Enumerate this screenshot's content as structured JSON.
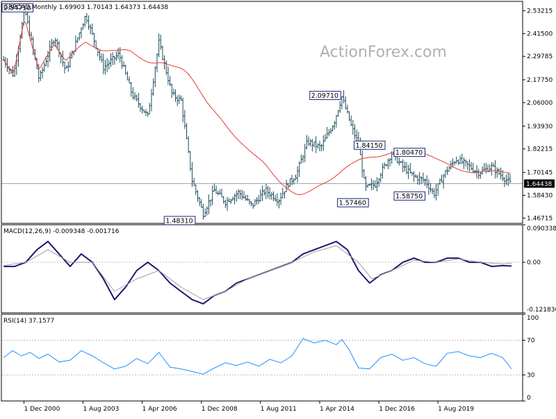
{
  "chart_data": [
    {
      "type": "ohlc",
      "panel": "price",
      "title": "GBPCAD,Monthly",
      "ohlc_header": "1.69903 1.70143 1.64373 1.64438",
      "ylim": [
        1.44,
        2.58
      ],
      "y_ticks": [
        "2.53215",
        "2.41500",
        "2.29785",
        "2.17750",
        "2.06000",
        "1.93930",
        "1.82215",
        "1.70145",
        "1.58430",
        "1.46715"
      ],
      "current_price": "1.64438",
      "ma_color": "#e53935",
      "bar_color": "#1a4a5a",
      "annotations": [
        {
          "label": "2.54710",
          "time": 2000.95,
          "value": 2.5471
        },
        {
          "label": "1.48310",
          "time": 2008.7,
          "value": 1.4831
        },
        {
          "label": "2.09710",
          "time": 2015.2,
          "value": 2.0971
        },
        {
          "label": "1.84150",
          "time": 2015.8,
          "value": 1.8415
        },
        {
          "label": "1.57460",
          "time": 2016.45,
          "value": 1.5746
        },
        {
          "label": "1.80470",
          "time": 2017.6,
          "value": 1.8047
        },
        {
          "label": "1.58750",
          "time": 2019.0,
          "value": 1.5875
        }
      ],
      "key_points": [
        [
          2000.0,
          2.28
        ],
        [
          2000.45,
          2.2
        ],
        [
          2000.95,
          2.54
        ],
        [
          2001.6,
          2.18
        ],
        [
          2002.3,
          2.4
        ],
        [
          2002.8,
          2.22
        ],
        [
          2003.7,
          2.51
        ],
        [
          2004.5,
          2.24
        ],
        [
          2005.2,
          2.31
        ],
        [
          2005.8,
          2.1
        ],
        [
          2006.5,
          1.99
        ],
        [
          2007.0,
          2.37
        ],
        [
          2007.6,
          2.1
        ],
        [
          2008.0,
          2.07
        ],
        [
          2008.5,
          1.66
        ],
        [
          2009.0,
          1.49
        ],
        [
          2009.5,
          1.61
        ],
        [
          2010.0,
          1.55
        ],
        [
          2010.6,
          1.6
        ],
        [
          2011.2,
          1.53
        ],
        [
          2011.8,
          1.61
        ],
        [
          2012.4,
          1.56
        ],
        [
          2012.8,
          1.64
        ],
        [
          2013.2,
          1.69
        ],
        [
          2013.7,
          1.86
        ],
        [
          2014.3,
          1.83
        ],
        [
          2014.9,
          1.96
        ],
        [
          2015.25,
          2.09
        ],
        [
          2015.7,
          1.93
        ],
        [
          2016.0,
          1.85
        ],
        [
          2016.3,
          1.62
        ],
        [
          2016.75,
          1.64
        ],
        [
          2017.0,
          1.7
        ],
        [
          2017.5,
          1.8
        ],
        [
          2018.0,
          1.73
        ],
        [
          2018.5,
          1.68
        ],
        [
          2019.0,
          1.66
        ],
        [
          2019.4,
          1.59
        ],
        [
          2019.9,
          1.7
        ],
        [
          2020.4,
          1.77
        ],
        [
          2020.9,
          1.74
        ],
        [
          2021.4,
          1.7
        ],
        [
          2022.0,
          1.73
        ],
        [
          2022.5,
          1.68
        ],
        [
          2022.9,
          1.64
        ]
      ]
    },
    {
      "type": "line",
      "panel": "macd",
      "title": "MACD(12,26,9) -0.009348 -0.001716",
      "ylim": [
        -0.121836,
        0.090338
      ],
      "y_ticks": [
        "0.090338",
        "0.00",
        "-0.121836"
      ],
      "zero_label": "0.00",
      "series": [
        {
          "role": "macd",
          "color": "#191970",
          "points": [
            [
              2000.0,
              -0.01
            ],
            [
              2000.5,
              -0.01
            ],
            [
              2001.0,
              0.0
            ],
            [
              2001.5,
              0.03
            ],
            [
              2002.0,
              0.05
            ],
            [
              2002.5,
              0.02
            ],
            [
              2003.0,
              -0.01
            ],
            [
              2003.5,
              0.02
            ],
            [
              2004.0,
              0.0
            ],
            [
              2004.5,
              -0.04
            ],
            [
              2005.0,
              -0.09
            ],
            [
              2005.5,
              -0.06
            ],
            [
              2006.0,
              -0.02
            ],
            [
              2006.5,
              0.0
            ],
            [
              2007.0,
              -0.02
            ],
            [
              2007.5,
              -0.05
            ],
            [
              2008.0,
              -0.07
            ],
            [
              2008.5,
              -0.09
            ],
            [
              2009.0,
              -0.1
            ],
            [
              2009.5,
              -0.08
            ],
            [
              2010.0,
              -0.07
            ],
            [
              2010.5,
              -0.05
            ],
            [
              2011.0,
              -0.04
            ],
            [
              2011.5,
              -0.03
            ],
            [
              2012.0,
              -0.02
            ],
            [
              2012.5,
              -0.01
            ],
            [
              2013.0,
              0.0
            ],
            [
              2013.5,
              0.02
            ],
            [
              2014.0,
              0.03
            ],
            [
              2014.5,
              0.04
            ],
            [
              2015.0,
              0.05
            ],
            [
              2015.5,
              0.03
            ],
            [
              2016.0,
              -0.02
            ],
            [
              2016.5,
              -0.05
            ],
            [
              2017.0,
              -0.03
            ],
            [
              2017.5,
              -0.02
            ],
            [
              2018.0,
              0.0
            ],
            [
              2018.5,
              0.01
            ],
            [
              2019.0,
              0.0
            ],
            [
              2019.5,
              0.0
            ],
            [
              2020.0,
              0.01
            ],
            [
              2020.5,
              0.01
            ],
            [
              2021.0,
              0.0
            ],
            [
              2021.5,
              0.0
            ],
            [
              2022.0,
              -0.01
            ],
            [
              2022.5,
              -0.008
            ],
            [
              2022.9,
              -0.009
            ]
          ]
        },
        {
          "role": "signal",
          "color": "#9e9e9e",
          "points": [
            [
              2000.0,
              -0.008
            ],
            [
              2001.0,
              0.0
            ],
            [
              2002.0,
              0.03
            ],
            [
              2003.0,
              0.0
            ],
            [
              2004.0,
              0.0
            ],
            [
              2005.0,
              -0.07
            ],
            [
              2006.0,
              -0.04
            ],
            [
              2007.0,
              -0.02
            ],
            [
              2008.0,
              -0.06
            ],
            [
              2009.0,
              -0.09
            ],
            [
              2010.0,
              -0.07
            ],
            [
              2011.0,
              -0.04
            ],
            [
              2012.0,
              -0.02
            ],
            [
              2013.0,
              0.0
            ],
            [
              2014.0,
              0.025
            ],
            [
              2015.0,
              0.04
            ],
            [
              2016.0,
              0.0
            ],
            [
              2016.6,
              -0.04
            ],
            [
              2017.5,
              -0.02
            ],
            [
              2018.5,
              0.005
            ],
            [
              2019.5,
              0.0
            ],
            [
              2020.5,
              0.008
            ],
            [
              2021.5,
              0.0
            ],
            [
              2022.5,
              -0.004
            ],
            [
              2022.9,
              -0.002
            ]
          ]
        }
      ]
    },
    {
      "type": "line",
      "panel": "rsi",
      "title": "RSI(14) 37.1577",
      "ylim": [
        0,
        100
      ],
      "y_ticks": [
        "100",
        "70",
        "30",
        "0"
      ],
      "levels": [
        70,
        30
      ],
      "series": [
        {
          "role": "rsi",
          "color": "#1e90ff",
          "points": [
            [
              2000.0,
              50
            ],
            [
              2000.4,
              58
            ],
            [
              2000.8,
              52
            ],
            [
              2001.2,
              56
            ],
            [
              2001.6,
              49
            ],
            [
              2002.0,
              54
            ],
            [
              2002.5,
              45
            ],
            [
              2003.0,
              47
            ],
            [
              2003.5,
              58
            ],
            [
              2004.0,
              52
            ],
            [
              2004.5,
              44
            ],
            [
              2005.0,
              37
            ],
            [
              2005.5,
              40
            ],
            [
              2006.0,
              49
            ],
            [
              2006.5,
              43
            ],
            [
              2007.0,
              56
            ],
            [
              2007.5,
              39
            ],
            [
              2008.0,
              37
            ],
            [
              2008.5,
              34
            ],
            [
              2009.0,
              31
            ],
            [
              2009.5,
              38
            ],
            [
              2010.0,
              44
            ],
            [
              2010.5,
              41
            ],
            [
              2011.0,
              45
            ],
            [
              2011.5,
              40
            ],
            [
              2012.0,
              48
            ],
            [
              2012.5,
              44
            ],
            [
              2013.0,
              52
            ],
            [
              2013.5,
              72
            ],
            [
              2014.0,
              67
            ],
            [
              2014.5,
              70
            ],
            [
              2015.0,
              65
            ],
            [
              2015.25,
              71
            ],
            [
              2015.6,
              58
            ],
            [
              2016.0,
              38
            ],
            [
              2016.5,
              37
            ],
            [
              2017.0,
              50
            ],
            [
              2017.5,
              54
            ],
            [
              2018.0,
              47
            ],
            [
              2018.5,
              50
            ],
            [
              2019.0,
              43
            ],
            [
              2019.5,
              40
            ],
            [
              2020.0,
              55
            ],
            [
              2020.5,
              57
            ],
            [
              2021.0,
              52
            ],
            [
              2021.5,
              50
            ],
            [
              2022.0,
              55
            ],
            [
              2022.5,
              50
            ],
            [
              2022.9,
              37
            ]
          ]
        }
      ]
    }
  ],
  "x_axis": {
    "range": [
      1999.9,
      2023.4
    ],
    "ticks": [
      {
        "label": "1 Dec 2000",
        "time": 2000.92
      },
      {
        "label": "1 Aug 2003",
        "time": 2003.58
      },
      {
        "label": "1 Apr 2006",
        "time": 2006.25
      },
      {
        "label": "1 Dec 2008",
        "time": 2008.92
      },
      {
        "label": "1 Aug 2011",
        "time": 2011.58
      },
      {
        "label": "1 Apr 2014",
        "time": 2014.25
      },
      {
        "label": "1 Dec 2016",
        "time": 2016.92
      },
      {
        "label": "1 Aug 2019",
        "time": 2019.58
      }
    ]
  },
  "watermark": "ActionForex.com"
}
